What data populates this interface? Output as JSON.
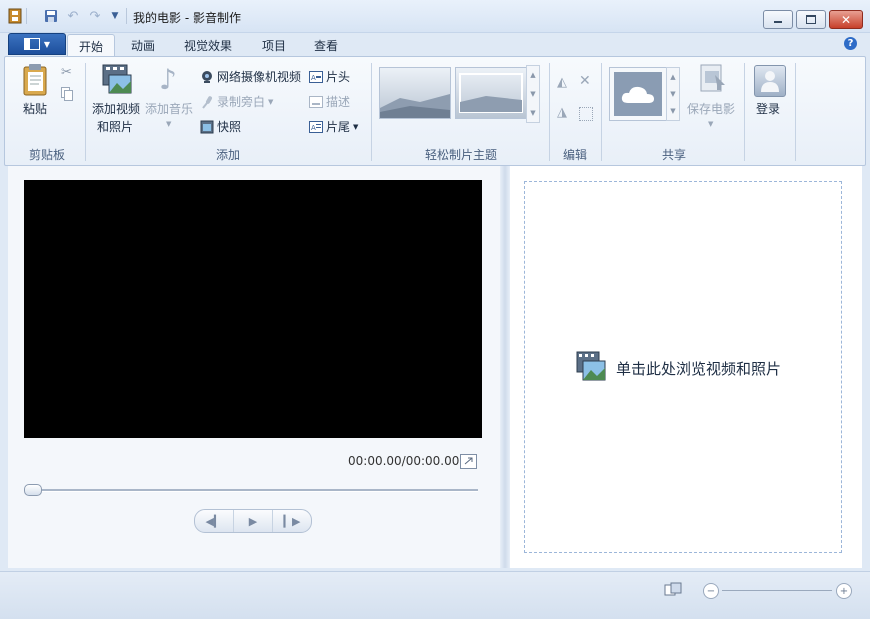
{
  "window": {
    "title": "我的电影 - 影音制作",
    "minimize_icon": "minimize-icon",
    "maximize_icon": "maximize-icon",
    "close_icon": "close-icon"
  },
  "quick_access": [
    "app-icon",
    "save-icon",
    "undo-icon",
    "redo-icon",
    "customize-dropdown-icon"
  ],
  "tabs": [
    {
      "label": "开始",
      "active": true
    },
    {
      "label": "动画",
      "active": false
    },
    {
      "label": "视觉效果",
      "active": false
    },
    {
      "label": "项目",
      "active": false
    },
    {
      "label": "查看",
      "active": false
    }
  ],
  "ribbon": {
    "clipboard": {
      "label": "剪贴板",
      "paste": "粘贴"
    },
    "add": {
      "label": "添加",
      "add_video_line1": "添加视频",
      "add_video_line2": "和照片",
      "add_music": "添加音乐",
      "webcam_video": "网络摄像机视频",
      "record_narration": "录制旁白",
      "snapshot": "快照",
      "title": "片头",
      "caption": "描述",
      "credits": "片尾"
    },
    "themes": {
      "label": "轻松制片主题"
    },
    "editing": {
      "label": "编辑"
    },
    "share": {
      "label": "共享",
      "save_movie": "保存电影"
    },
    "signin": {
      "label": "登录"
    }
  },
  "preview": {
    "timecode": "00:00.00/00:00.00"
  },
  "storyboard": {
    "browse_text": "单击此处浏览视频和照片"
  },
  "colors": {
    "accent": "#1d4f9c",
    "background": "#dfe9f5",
    "preview": "#000000"
  }
}
